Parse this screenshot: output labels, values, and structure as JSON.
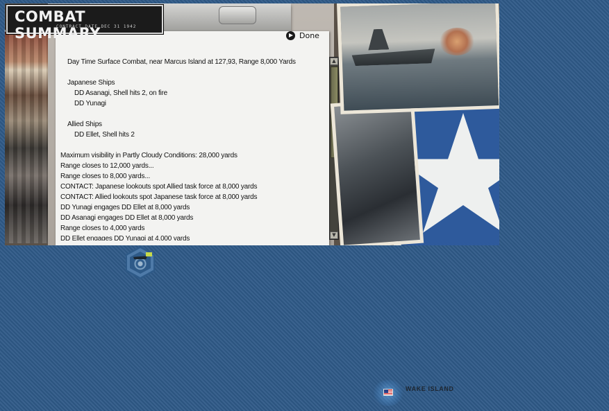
{
  "window": {
    "title": "COMBAT SUMMARY",
    "subtitle": "CONTRACT DATE DEC 31 1942",
    "done_label": "Done"
  },
  "report": {
    "header": "Day Time Surface Combat, near Marcus Island at 127,93, Range 8,000 Yards",
    "japanese_title": "Japanese Ships",
    "japanese_ships": [
      "DD Asanagi, Shell hits 2,  on fire",
      "DD Yunagi"
    ],
    "allied_title": "Allied Ships",
    "allied_ships": [
      "DD Ellet, Shell hits 2"
    ],
    "events": [
      "Maximum visibility in Partly Cloudy Conditions: 28,000 yards",
      "Range closes to 12,000 yards...",
      "Range closes to 8,000 yards...",
      "CONTACT: Japanese lookouts spot Allied task force at 8,000 yards",
      "CONTACT: Allied lookouts spot Japanese task force at 8,000 yards",
      "DD Yunagi engages DD Ellet at 8,000 yards",
      "DD Asanagi engages DD Ellet at 8,000 yards",
      "Range closes to 4,000 yards",
      "DD Ellet engages DD Yunagi at 4,000 yards"
    ]
  },
  "map": {
    "base_label": "WAKE ISLAND"
  },
  "icons": {
    "done": "arrow-right-circle-icon",
    "base_flag": "us-flag-icon",
    "unit": "naval-task-force-icon"
  },
  "colors": {
    "ocean": "#2f5a88",
    "paper": "#f3f3f1",
    "insignia_blue": "#2e5a9c"
  }
}
